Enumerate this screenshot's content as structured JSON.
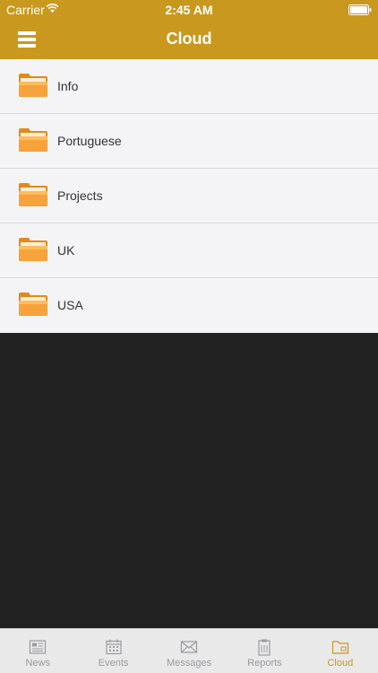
{
  "status_bar": {
    "carrier": "Carrier",
    "time": "2:45 AM"
  },
  "header": {
    "title": "Cloud",
    "menu_icon": "hamburger-menu-icon"
  },
  "folders": [
    {
      "label": "Info",
      "icon": "folder-icon"
    },
    {
      "label": "Portuguese",
      "icon": "folder-icon"
    },
    {
      "label": "Projects",
      "icon": "folder-icon"
    },
    {
      "label": "UK",
      "icon": "folder-icon"
    },
    {
      "label": "USA",
      "icon": "folder-icon"
    }
  ],
  "tabs": [
    {
      "label": "News",
      "icon": "newspaper-icon",
      "active": false
    },
    {
      "label": "Events",
      "icon": "calendar-icon",
      "active": false
    },
    {
      "label": "Messages",
      "icon": "envelope-icon",
      "active": false
    },
    {
      "label": "Reports",
      "icon": "clipboard-icon",
      "active": false
    },
    {
      "label": "Cloud",
      "icon": "folder-tab-icon",
      "active": true
    }
  ],
  "colors": {
    "accent": "#c9991f",
    "background": "#222222",
    "list_bg": "#f4f4f6"
  }
}
